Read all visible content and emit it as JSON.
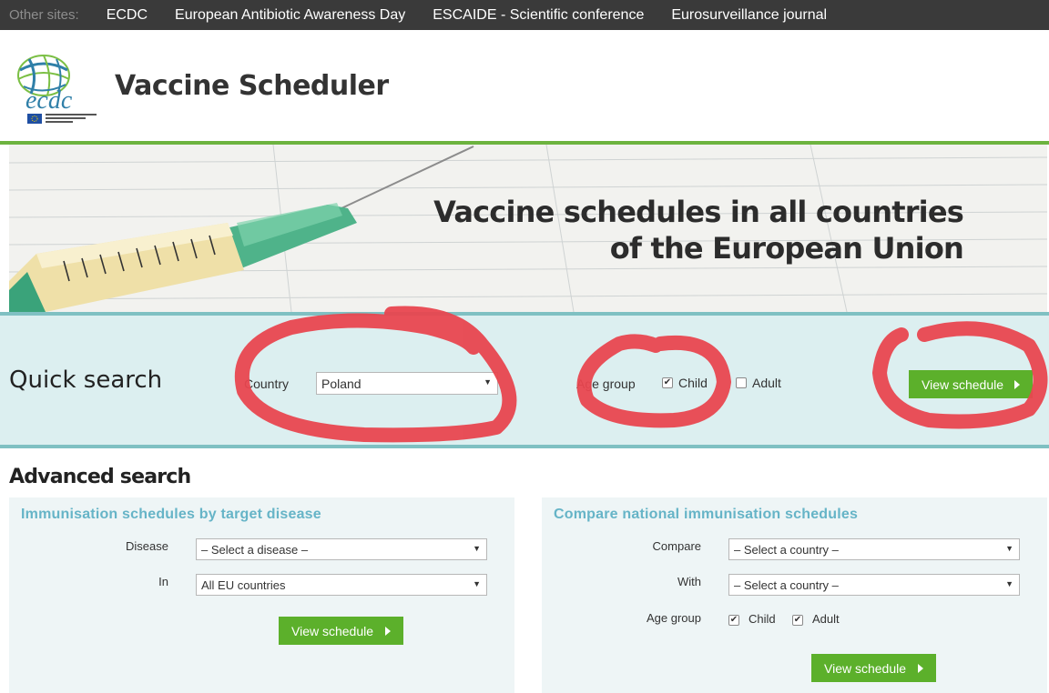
{
  "topbar": {
    "other_sites": "Other sites:",
    "links": [
      "ECDC",
      "European Antibiotic Awareness Day",
      "ESCAIDE - Scientific conference",
      "Eurosurveillance journal"
    ]
  },
  "header": {
    "logo_text": "ecdc",
    "logo_subtext": "EUROPEAN CENTRE FOR DISEASE PREVENTION AND CONTROL",
    "title": "Vaccine Scheduler"
  },
  "banner": {
    "line1": "Vaccine schedules in all countries",
    "line2": "of the European Union"
  },
  "quick_search": {
    "title": "Quick search",
    "country_label": "Country",
    "country_value": "Poland",
    "age_group_label": "Age group",
    "child_label": "Child",
    "child_checked": true,
    "adult_label": "Adult",
    "adult_checked": false,
    "button": "View schedule"
  },
  "advanced": {
    "title": "Advanced search",
    "by_disease": {
      "title": "Immunisation schedules by target disease",
      "disease_label": "Disease",
      "disease_value": "– Select a disease –",
      "in_label": "In",
      "in_value": "All EU countries",
      "button": "View schedule"
    },
    "compare": {
      "title": "Compare national immunisation schedules",
      "compare_label": "Compare",
      "compare_value": "– Select a country –",
      "with_label": "With",
      "with_value": "– Select a country –",
      "age_group_label": "Age group",
      "child_label": "Child",
      "child_checked": true,
      "adult_label": "Adult",
      "adult_checked": true,
      "button": "View schedule"
    }
  },
  "colors": {
    "topbar": "#3a3a3a",
    "accent_green": "#6db33f",
    "button_green": "#5cb02b",
    "quick_bg": "#dceff0",
    "panel_title": "#66b4c7",
    "annotation_red": "#e8464f"
  }
}
